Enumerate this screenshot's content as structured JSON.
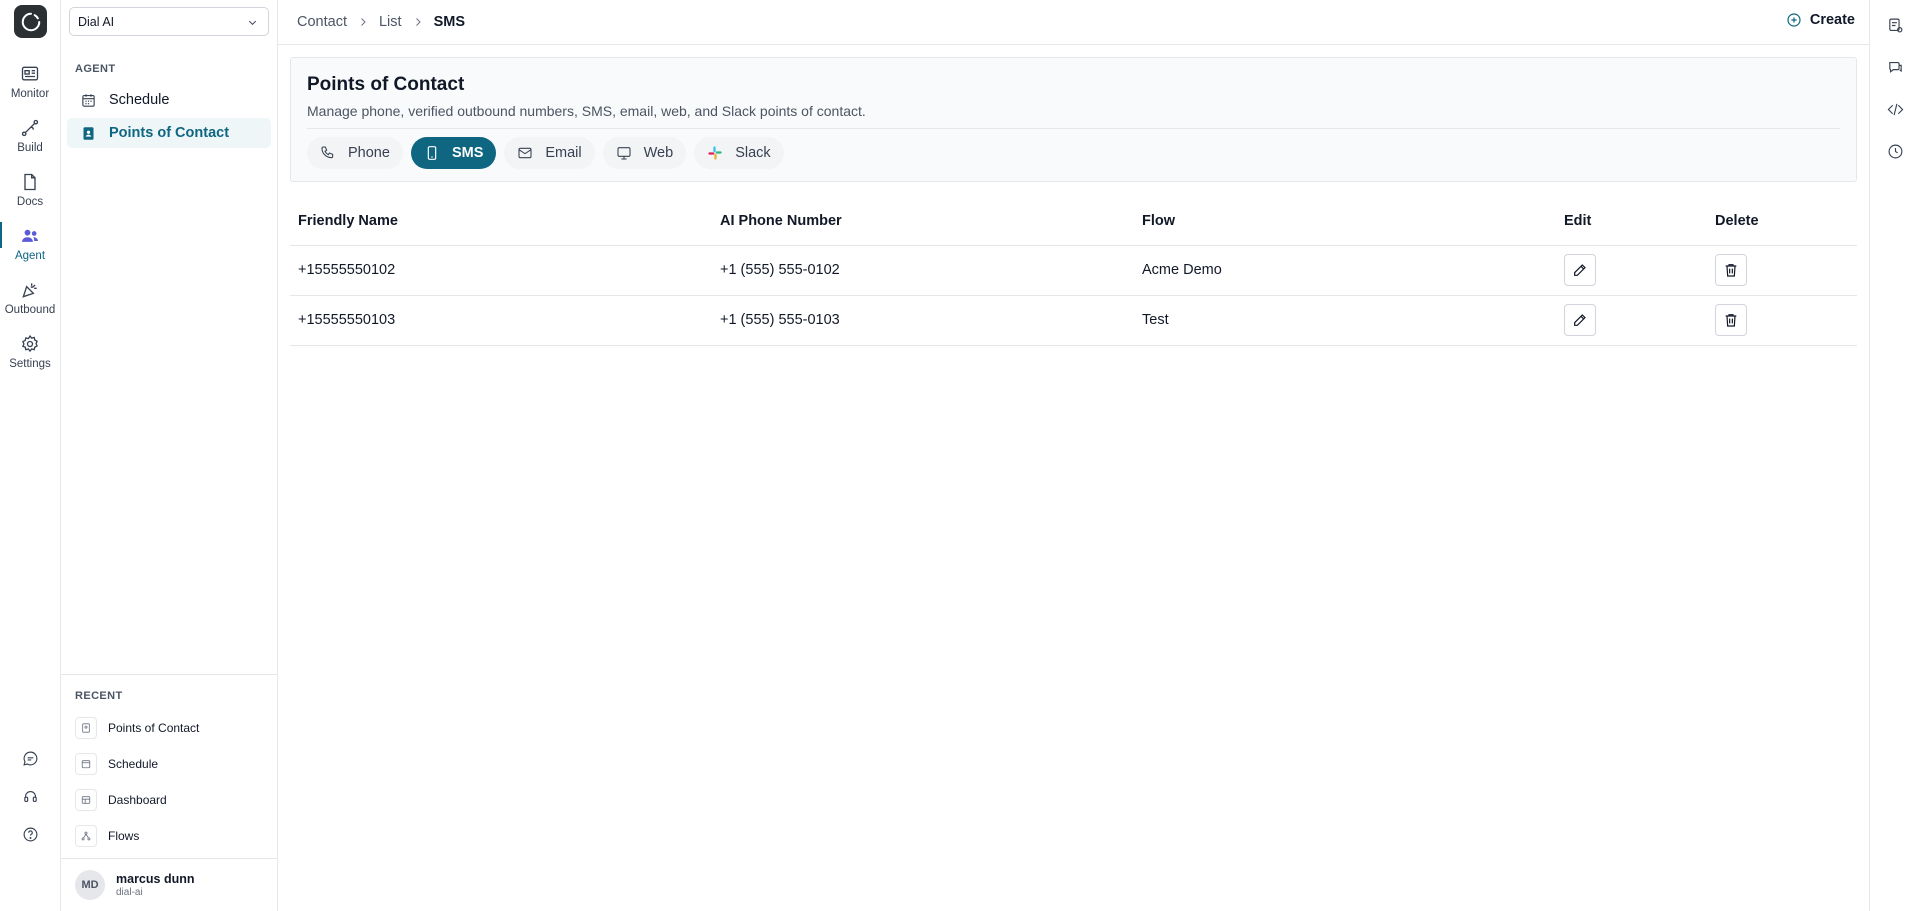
{
  "rail": {
    "items": [
      {
        "label": "Monitor",
        "icon": "monitor-icon"
      },
      {
        "label": "Build",
        "icon": "build-icon"
      },
      {
        "label": "Docs",
        "icon": "docs-icon"
      },
      {
        "label": "Agent",
        "icon": "agent-icon",
        "active": true
      },
      {
        "label": "Outbound",
        "icon": "outbound-icon"
      },
      {
        "label": "Settings",
        "icon": "gear-icon"
      }
    ]
  },
  "sidebar": {
    "workspace": "Dial AI",
    "section_title": "AGENT",
    "items": [
      {
        "label": "Schedule",
        "icon": "calendar-icon"
      },
      {
        "label": "Points of Contact",
        "icon": "contact-book-icon",
        "active": true
      }
    ],
    "recent_title": "RECENT",
    "recent": [
      {
        "label": "Points of Contact"
      },
      {
        "label": "Schedule"
      },
      {
        "label": "Dashboard"
      },
      {
        "label": "Flows"
      }
    ],
    "user": {
      "initials": "MD",
      "name": "marcus dunn",
      "org": "dial-ai"
    }
  },
  "breadcrumb": {
    "items": [
      "Contact",
      "List",
      "SMS"
    ]
  },
  "header": {
    "create_label": "Create"
  },
  "page": {
    "title": "Points of Contact",
    "description": "Manage phone, verified outbound numbers, SMS, email, web, and Slack points of contact.",
    "tabs": [
      {
        "label": "Phone",
        "icon": "phone-icon"
      },
      {
        "label": "SMS",
        "icon": "mobile-icon",
        "active": true
      },
      {
        "label": "Email",
        "icon": "mail-icon"
      },
      {
        "label": "Web",
        "icon": "monitor-screen-icon"
      },
      {
        "label": "Slack",
        "icon": "slack-icon"
      }
    ]
  },
  "table": {
    "headers": [
      "Friendly Name",
      "AI Phone Number",
      "Flow",
      "Edit",
      "Delete"
    ],
    "rows": [
      {
        "friendly_name": "+15555550102",
        "ai_phone_number": "+1 (555) 555-0102",
        "flow": "Acme Demo"
      },
      {
        "friendly_name": "+15555550103",
        "ai_phone_number": "+1 (555) 555-0103",
        "flow": "Test"
      }
    ]
  },
  "colors": {
    "accent": "#0e6680",
    "active_bg": "#eff6f8",
    "border": "#e5e7eb"
  }
}
